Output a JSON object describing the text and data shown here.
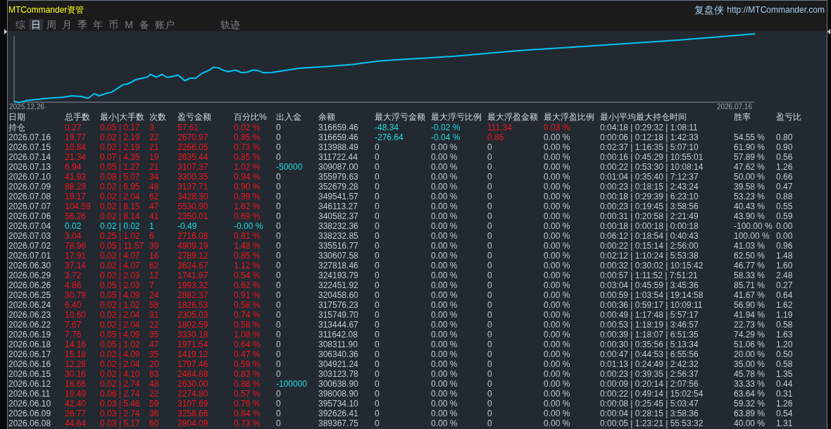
{
  "window": {
    "title": "MTCommander资管"
  },
  "header": {
    "site_name": "复盘侠",
    "url": "http://MTCommander.com"
  },
  "tabs": [
    {
      "label": "综",
      "selected": false
    },
    {
      "label": "日",
      "selected": true
    },
    {
      "label": "周",
      "selected": false
    },
    {
      "label": "月",
      "selected": false
    },
    {
      "label": "季",
      "selected": false
    },
    {
      "label": "年",
      "selected": false
    },
    {
      "label": "币",
      "selected": false
    },
    {
      "label": "M",
      "selected": false
    },
    {
      "label": "备",
      "selected": false
    },
    {
      "label": "账户",
      "selected": false
    }
  ],
  "tools": [
    {
      "label": "轨迹",
      "selected": false
    }
  ],
  "chart": {
    "start_label": "2025.12.26",
    "end_label": "2026.07.16"
  },
  "table": {
    "columns": [
      "日期",
      "总手数",
      "最小|大手数",
      "次数",
      "盈亏金额",
      "百分比%",
      "出入金",
      "余额",
      "最大浮亏金额",
      "最大浮亏比例",
      "最大浮盈金额",
      "最大浮盈比例",
      "最小|平均最大持仓时间",
      "胜率",
      "盈亏比"
    ],
    "rows": [
      {
        "cells": [
          {
            "text": "持仓"
          },
          {
            "text": "0.27",
            "color": "#f0161e"
          },
          {
            "text": "0.05 | 0.17",
            "color": "#f0161e"
          },
          {
            "text": "3",
            "color": "#f0161e"
          },
          {
            "text": "57.61",
            "color": "#f0161e"
          },
          {
            "text": "0.02 %",
            "color": "#f0161e"
          },
          {
            "text": "0"
          },
          {
            "text": "316659.46"
          },
          {
            "text": "-48.34",
            "color": "#1fdde3"
          },
          {
            "text": "-0.02 %",
            "color": "#1fdde3"
          },
          {
            "text": "111.34",
            "color": "#f0161e"
          },
          {
            "text": "0.03 %",
            "color": "#f0161e"
          },
          {
            "text": "0:04:18 | 0:29:32 | 1:08:11"
          }
        ]
      },
      {
        "cells": [
          {
            "text": "2026.07.16"
          },
          {
            "text": "19.77",
            "color": "#f0161e"
          },
          {
            "text": "0.02 | 2.19",
            "color": "#f0161e"
          },
          {
            "text": "22",
            "color": "#f0161e"
          },
          {
            "text": "2670.97",
            "color": "#f0161e"
          },
          {
            "text": "0.85 %",
            "color": "#f0161e"
          },
          {
            "text": "0"
          },
          {
            "text": "316659.46"
          },
          {
            "text": "-276.64",
            "color": "#1fdde3"
          },
          {
            "text": "-0.04 %",
            "color": "#1fdde3"
          },
          {
            "text": "0.85",
            "color": "#f0161e"
          },
          {
            "text": "0.00 %"
          },
          {
            "text": "0:00:06 | 0:12:18 | 1:42:33"
          },
          {
            "text": "54.55 %"
          },
          {
            "text": "0.80"
          }
        ]
      },
      {
        "cells": [
          {
            "text": "2026.07.15"
          },
          {
            "text": "10.84",
            "color": "#f0161e"
          },
          {
            "text": "0.02 | 2.19",
            "color": "#f0161e"
          },
          {
            "text": "21",
            "color": "#f0161e"
          },
          {
            "text": "2266.05",
            "color": "#f0161e"
          },
          {
            "text": "0.73 %",
            "color": "#f0161e"
          },
          {
            "text": "0"
          },
          {
            "text": "313988.49"
          },
          {
            "text": "0"
          },
          {
            "text": "0.00 %"
          },
          {
            "text": "0"
          },
          {
            "text": "0.00 %"
          },
          {
            "text": "0:02:37 | 1:16:35 | 5:07:10"
          },
          {
            "text": "61.90 %"
          },
          {
            "text": "0.90"
          }
        ]
      },
      {
        "cells": [
          {
            "text": "2026.07.14"
          },
          {
            "text": "21.34",
            "color": "#f0161e"
          },
          {
            "text": "0.07 | 4.35",
            "color": "#f0161e"
          },
          {
            "text": "19",
            "color": "#f0161e"
          },
          {
            "text": "2635.44",
            "color": "#f0161e"
          },
          {
            "text": "0.85 %",
            "color": "#f0161e"
          },
          {
            "text": "0"
          },
          {
            "text": "311722.44"
          },
          {
            "text": "0"
          },
          {
            "text": "0.00 %"
          },
          {
            "text": "0"
          },
          {
            "text": "0.00 %"
          },
          {
            "text": "0:00:16 | 0:45:29 | 10:55:01"
          },
          {
            "text": "57.89 %"
          },
          {
            "text": "0.56"
          }
        ]
      },
      {
        "cells": [
          {
            "text": "2026.07.13"
          },
          {
            "text": "6.94",
            "color": "#f0161e"
          },
          {
            "text": "0.05 | 1.27",
            "color": "#f0161e"
          },
          {
            "text": "21",
            "color": "#f0161e"
          },
          {
            "text": "3107.37",
            "color": "#f0161e"
          },
          {
            "text": "1.02 %",
            "color": "#f0161e"
          },
          {
            "text": "-50000",
            "color": "#1fdde3"
          },
          {
            "text": "309087.00"
          },
          {
            "text": "0"
          },
          {
            "text": "0.00 %"
          },
          {
            "text": "0"
          },
          {
            "text": "0.00 %"
          },
          {
            "text": "0:00:22 | 0:53:30 | 10:08:14"
          },
          {
            "text": "47.62 %"
          },
          {
            "text": "1.26"
          }
        ]
      },
      {
        "cells": [
          {
            "text": "2026.07.10"
          },
          {
            "text": "41.93",
            "color": "#f0161e"
          },
          {
            "text": "0.08 | 5.07",
            "color": "#f0161e"
          },
          {
            "text": "34",
            "color": "#f0161e"
          },
          {
            "text": "3300.35",
            "color": "#f0161e"
          },
          {
            "text": "0.94 %",
            "color": "#f0161e"
          },
          {
            "text": "0"
          },
          {
            "text": "355979.63"
          },
          {
            "text": "0"
          },
          {
            "text": "0.00 %"
          },
          {
            "text": "0"
          },
          {
            "text": "0.00 %"
          },
          {
            "text": "0:01:04 | 0:35:40 | 7:12:37"
          },
          {
            "text": "50.00 %"
          },
          {
            "text": "0.66"
          }
        ]
      },
      {
        "cells": [
          {
            "text": "2026.07.09"
          },
          {
            "text": "88.29",
            "color": "#f0161e"
          },
          {
            "text": "0.02 | 6.95",
            "color": "#f0161e"
          },
          {
            "text": "48",
            "color": "#f0161e"
          },
          {
            "text": "3137.71",
            "color": "#f0161e"
          },
          {
            "text": "0.90 %",
            "color": "#f0161e"
          },
          {
            "text": "0"
          },
          {
            "text": "352679.28"
          },
          {
            "text": "0"
          },
          {
            "text": "0.00 %"
          },
          {
            "text": "0"
          },
          {
            "text": "0.00 %"
          },
          {
            "text": "0:00:23 | 0:18:15 | 2:43:24"
          },
          {
            "text": "39.58 %"
          },
          {
            "text": "0.47"
          }
        ]
      },
      {
        "cells": [
          {
            "text": "2026.07.08"
          },
          {
            "text": "19.17",
            "color": "#f0161e"
          },
          {
            "text": "0.02 | 2.04",
            "color": "#f0161e"
          },
          {
            "text": "62",
            "color": "#f0161e"
          },
          {
            "text": "3428.30",
            "color": "#f0161e"
          },
          {
            "text": "0.99 %",
            "color": "#f0161e"
          },
          {
            "text": "0"
          },
          {
            "text": "349541.57"
          },
          {
            "text": "0"
          },
          {
            "text": "0.00 %"
          },
          {
            "text": "0"
          },
          {
            "text": "0.00 %"
          },
          {
            "text": "0:00:18 | 0:29:39 | 6:23:10"
          },
          {
            "text": "53.23 %"
          },
          {
            "text": "0.88"
          }
        ]
      },
      {
        "cells": [
          {
            "text": "2026.07.07"
          },
          {
            "text": "104.59",
            "color": "#f0161e"
          },
          {
            "text": "0.02 | 8.15",
            "color": "#f0161e"
          },
          {
            "text": "47",
            "color": "#f0161e"
          },
          {
            "text": "5530.90",
            "color": "#f0161e"
          },
          {
            "text": "1.62 %",
            "color": "#f0161e"
          },
          {
            "text": "0"
          },
          {
            "text": "346113.27"
          },
          {
            "text": "0"
          },
          {
            "text": "0.00 %"
          },
          {
            "text": "0"
          },
          {
            "text": "0.00 %"
          },
          {
            "text": "0:00:23 | 0:19:45 | 3:58:56"
          },
          {
            "text": "40.43 %"
          },
          {
            "text": "0.55"
          }
        ]
      },
      {
        "cells": [
          {
            "text": "2026.07.06"
          },
          {
            "text": "56.26",
            "color": "#f0161e"
          },
          {
            "text": "0.02 | 8.14",
            "color": "#f0161e"
          },
          {
            "text": "41",
            "color": "#f0161e"
          },
          {
            "text": "2350.01",
            "color": "#f0161e"
          },
          {
            "text": "0.69 %",
            "color": "#f0161e"
          },
          {
            "text": "0"
          },
          {
            "text": "340582.37"
          },
          {
            "text": "0"
          },
          {
            "text": "0.00 %"
          },
          {
            "text": "0"
          },
          {
            "text": "0.00 %"
          },
          {
            "text": "0:00:31 | 0:20:58 | 2:21:49"
          },
          {
            "text": "43.90 %"
          },
          {
            "text": "0.59"
          }
        ]
      },
      {
        "cells": [
          {
            "text": "2026.07.04"
          },
          {
            "text": "0.02",
            "color": "#1fdde3"
          },
          {
            "text": "0.02 | 0.02",
            "color": "#1fdde3"
          },
          {
            "text": "1",
            "color": "#1fdde3"
          },
          {
            "text": "-0.49",
            "color": "#1fdde3"
          },
          {
            "text": "-0.00 %",
            "color": "#1fdde3"
          },
          {
            "text": "0"
          },
          {
            "text": "338232.36"
          },
          {
            "text": "0"
          },
          {
            "text": "0.00 %"
          },
          {
            "text": "0"
          },
          {
            "text": "0.00 %"
          },
          {
            "text": "0:00:18 | 0:00:18 | 0:00:18"
          },
          {
            "text": "-100.00 %"
          },
          {
            "text": "0.00"
          }
        ]
      },
      {
        "cells": [
          {
            "text": "2026.07.03"
          },
          {
            "text": "3.04",
            "color": "#f0161e"
          },
          {
            "text": "0.25 | 1.02",
            "color": "#f0161e"
          },
          {
            "text": "6",
            "color": "#f0161e"
          },
          {
            "text": "2716.08",
            "color": "#f0161e"
          },
          {
            "text": "0.81 %",
            "color": "#f0161e"
          },
          {
            "text": "0"
          },
          {
            "text": "338232.85"
          },
          {
            "text": "0"
          },
          {
            "text": "0.00 %"
          },
          {
            "text": "0"
          },
          {
            "text": "0.00 %"
          },
          {
            "text": "0:06:12 | 0:18:54 | 0:40:43"
          },
          {
            "text": "100.00 %"
          },
          {
            "text": "0.00"
          }
        ]
      },
      {
        "cells": [
          {
            "text": "2026.07.02"
          },
          {
            "text": "78.96",
            "color": "#f0161e"
          },
          {
            "text": "0.05 | 11.57",
            "color": "#f0161e"
          },
          {
            "text": "39",
            "color": "#f0161e"
          },
          {
            "text": "4909.19",
            "color": "#f0161e"
          },
          {
            "text": "1.48 %",
            "color": "#f0161e"
          },
          {
            "text": "0"
          },
          {
            "text": "335516.77"
          },
          {
            "text": "0"
          },
          {
            "text": "0.00 %"
          },
          {
            "text": "0"
          },
          {
            "text": "0.00 %"
          },
          {
            "text": "0:00:22 | 0:15:14 | 2:56:00"
          },
          {
            "text": "41.03 %"
          },
          {
            "text": "0.96"
          }
        ]
      },
      {
        "cells": [
          {
            "text": "2026.07.01"
          },
          {
            "text": "17.91",
            "color": "#f0161e"
          },
          {
            "text": "0.02 | 4.07",
            "color": "#f0161e"
          },
          {
            "text": "16",
            "color": "#f0161e"
          },
          {
            "text": "2789.12",
            "color": "#f0161e"
          },
          {
            "text": "0.85 %",
            "color": "#f0161e"
          },
          {
            "text": "0"
          },
          {
            "text": "330607.58"
          },
          {
            "text": "0"
          },
          {
            "text": "0.00 %"
          },
          {
            "text": "0"
          },
          {
            "text": "0.00 %"
          },
          {
            "text": "0:02:12 | 1:10:24 | 5:53:38"
          },
          {
            "text": "62.50 %"
          },
          {
            "text": "1.48"
          }
        ]
      },
      {
        "cells": [
          {
            "text": "2026.06.30"
          },
          {
            "text": "37.14",
            "color": "#f0161e"
          },
          {
            "text": "0.02 | 4.07",
            "color": "#f0161e"
          },
          {
            "text": "62",
            "color": "#f0161e"
          },
          {
            "text": "3624.67",
            "color": "#f0161e"
          },
          {
            "text": "1.12 %",
            "color": "#f0161e"
          },
          {
            "text": "0"
          },
          {
            "text": "327818.46"
          },
          {
            "text": "0"
          },
          {
            "text": "0.00 %"
          },
          {
            "text": "0"
          },
          {
            "text": "0.00 %"
          },
          {
            "text": "0:00:32 | 0:30:02 | 10:15:42"
          },
          {
            "text": "46.77 %"
          },
          {
            "text": "1.60"
          }
        ]
      },
      {
        "cells": [
          {
            "text": "2026.06.29"
          },
          {
            "text": "3.72",
            "color": "#f0161e"
          },
          {
            "text": "0.02 | 2.03",
            "color": "#f0161e"
          },
          {
            "text": "12",
            "color": "#f0161e"
          },
          {
            "text": "1741.87",
            "color": "#f0161e"
          },
          {
            "text": "0.54 %",
            "color": "#f0161e"
          },
          {
            "text": "0"
          },
          {
            "text": "324193.79"
          },
          {
            "text": "0"
          },
          {
            "text": "0.00 %"
          },
          {
            "text": "0"
          },
          {
            "text": "0.00 %"
          },
          {
            "text": "0:00:57 | 1:11:52 | 7:51:21"
          },
          {
            "text": "58.33 %"
          },
          {
            "text": "2.48"
          }
        ]
      },
      {
        "cells": [
          {
            "text": "2026.06.26"
          },
          {
            "text": "4.86",
            "color": "#f0161e"
          },
          {
            "text": "0.05 | 2.03",
            "color": "#f0161e"
          },
          {
            "text": "7",
            "color": "#f0161e"
          },
          {
            "text": "1993.32",
            "color": "#f0161e"
          },
          {
            "text": "0.62 %",
            "color": "#f0161e"
          },
          {
            "text": "0"
          },
          {
            "text": "322451.92"
          },
          {
            "text": "0"
          },
          {
            "text": "0.00 %"
          },
          {
            "text": "0"
          },
          {
            "text": "0.00 %"
          },
          {
            "text": "0:03:04 | 0:45:59 | 3:45:36"
          },
          {
            "text": "85.71 %"
          },
          {
            "text": "0.27"
          }
        ]
      },
      {
        "cells": [
          {
            "text": "2026.06.25"
          },
          {
            "text": "30.79",
            "color": "#f0161e"
          },
          {
            "text": "0.05 | 4.09",
            "color": "#f0161e"
          },
          {
            "text": "24",
            "color": "#f0161e"
          },
          {
            "text": "2882.37",
            "color": "#f0161e"
          },
          {
            "text": "0.91 %",
            "color": "#f0161e"
          },
          {
            "text": "0"
          },
          {
            "text": "320458.60"
          },
          {
            "text": "0"
          },
          {
            "text": "0.00 %"
          },
          {
            "text": "0"
          },
          {
            "text": "0.00 %"
          },
          {
            "text": "0:00:59 | 1:03:54 | 19:14:58"
          },
          {
            "text": "41.67 %"
          },
          {
            "text": "0.64"
          }
        ]
      },
      {
        "cells": [
          {
            "text": "2026.06.24"
          },
          {
            "text": "6.40",
            "color": "#f0161e"
          },
          {
            "text": "0.02 | 1.02",
            "color": "#f0161e"
          },
          {
            "text": "58",
            "color": "#f0161e"
          },
          {
            "text": "1826.53",
            "color": "#f0161e"
          },
          {
            "text": "0.58 %",
            "color": "#f0161e"
          },
          {
            "text": "0"
          },
          {
            "text": "317576.23"
          },
          {
            "text": "0"
          },
          {
            "text": "0.00 %"
          },
          {
            "text": "0"
          },
          {
            "text": "0.00 %"
          },
          {
            "text": "0:00:36 | 0:59:17 | 10:09:11"
          },
          {
            "text": "56.90 %"
          },
          {
            "text": "1.62"
          }
        ]
      },
      {
        "cells": [
          {
            "text": "2026.06.23"
          },
          {
            "text": "10.60",
            "color": "#f0161e"
          },
          {
            "text": "0.02 | 2.04",
            "color": "#f0161e"
          },
          {
            "text": "31",
            "color": "#f0161e"
          },
          {
            "text": "2305.03",
            "color": "#f0161e"
          },
          {
            "text": "0.74 %",
            "color": "#f0161e"
          },
          {
            "text": "0"
          },
          {
            "text": "315749.70"
          },
          {
            "text": "0"
          },
          {
            "text": "0.00 %"
          },
          {
            "text": "0"
          },
          {
            "text": "0.00 %"
          },
          {
            "text": "0:00:49 | 1:17:48 | 5:57:17"
          },
          {
            "text": "41.94 %"
          },
          {
            "text": "1.19"
          }
        ]
      },
      {
        "cells": [
          {
            "text": "2026.06.22"
          },
          {
            "text": "7.67",
            "color": "#f0161e"
          },
          {
            "text": "0.02 | 2.04",
            "color": "#f0161e"
          },
          {
            "text": "22",
            "color": "#f0161e"
          },
          {
            "text": "1802.59",
            "color": "#f0161e"
          },
          {
            "text": "0.58 %",
            "color": "#f0161e"
          },
          {
            "text": "0"
          },
          {
            "text": "313444.67"
          },
          {
            "text": "0"
          },
          {
            "text": "0.00 %"
          },
          {
            "text": "0"
          },
          {
            "text": "0.00 %"
          },
          {
            "text": "0:00:53 | 1:18:19 | 3:46:57"
          },
          {
            "text": "22.73 %"
          },
          {
            "text": "0.58"
          }
        ]
      },
      {
        "cells": [
          {
            "text": "2026.06.19"
          },
          {
            "text": "7.76",
            "color": "#f0161e"
          },
          {
            "text": "0.05 | 4.09",
            "color": "#f0161e"
          },
          {
            "text": "35",
            "color": "#f0161e"
          },
          {
            "text": "3330.18",
            "color": "#f0161e"
          },
          {
            "text": "1.08 %",
            "color": "#f0161e"
          },
          {
            "text": "0"
          },
          {
            "text": "311642.08"
          },
          {
            "text": "0"
          },
          {
            "text": "0.00 %"
          },
          {
            "text": "0"
          },
          {
            "text": "0.00 %"
          },
          {
            "text": "0:00:39 | 1:18:07 | 6:51:35"
          },
          {
            "text": "74.29 %"
          },
          {
            "text": "1.63"
          }
        ]
      },
      {
        "cells": [
          {
            "text": "2026.06.18"
          },
          {
            "text": "14.16",
            "color": "#f0161e"
          },
          {
            "text": "0.05 | 1.02",
            "color": "#f0161e"
          },
          {
            "text": "47",
            "color": "#f0161e"
          },
          {
            "text": "1971.54",
            "color": "#f0161e"
          },
          {
            "text": "0.64 %",
            "color": "#f0161e"
          },
          {
            "text": "0"
          },
          {
            "text": "308311.90"
          },
          {
            "text": "0"
          },
          {
            "text": "0.00 %"
          },
          {
            "text": "0"
          },
          {
            "text": "0.00 %"
          },
          {
            "text": "0:00:30 | 0:35:56 | 5:13:34"
          },
          {
            "text": "51.06 %"
          },
          {
            "text": "1.20"
          }
        ]
      },
      {
        "cells": [
          {
            "text": "2026.06.17"
          },
          {
            "text": "15.18",
            "color": "#f0161e"
          },
          {
            "text": "0.02 | 4.09",
            "color": "#f0161e"
          },
          {
            "text": "35",
            "color": "#f0161e"
          },
          {
            "text": "1419.12",
            "color": "#f0161e"
          },
          {
            "text": "0.47 %",
            "color": "#f0161e"
          },
          {
            "text": "0"
          },
          {
            "text": "306340.36"
          },
          {
            "text": "0"
          },
          {
            "text": "0.00 %"
          },
          {
            "text": "0"
          },
          {
            "text": "0.00 %"
          },
          {
            "text": "0:00:47 | 0:44:53 | 6:55:56"
          },
          {
            "text": "20.00 %"
          },
          {
            "text": "0.50"
          }
        ]
      },
      {
        "cells": [
          {
            "text": "2026.06.16"
          },
          {
            "text": "12.28",
            "color": "#f0161e"
          },
          {
            "text": "0.02 | 2.04",
            "color": "#f0161e"
          },
          {
            "text": "20",
            "color": "#f0161e"
          },
          {
            "text": "1797.46",
            "color": "#f0161e"
          },
          {
            "text": "0.59 %",
            "color": "#f0161e"
          },
          {
            "text": "0"
          },
          {
            "text": "304921.24"
          },
          {
            "text": "0"
          },
          {
            "text": "0.00 %"
          },
          {
            "text": "0"
          },
          {
            "text": "0.00 %"
          },
          {
            "text": "0:01:13 | 0:24:49 | 2:42:32"
          },
          {
            "text": "35.00 %"
          },
          {
            "text": "0.58"
          }
        ]
      },
      {
        "cells": [
          {
            "text": "2026.06.15"
          },
          {
            "text": "30.16",
            "color": "#f0161e"
          },
          {
            "text": "0.02 | 4.10",
            "color": "#f0161e"
          },
          {
            "text": "83",
            "color": "#f0161e"
          },
          {
            "text": "2484.88",
            "color": "#f0161e"
          },
          {
            "text": "0.83 %",
            "color": "#f0161e"
          },
          {
            "text": "0"
          },
          {
            "text": "303123.78"
          },
          {
            "text": "0"
          },
          {
            "text": "0.00 %"
          },
          {
            "text": "0"
          },
          {
            "text": "0.00 %"
          },
          {
            "text": "0:00:23 | 0:39:35 | 2:56:37"
          },
          {
            "text": "45.78 %"
          },
          {
            "text": "1.35"
          }
        ]
      },
      {
        "cells": [
          {
            "text": "2026.06.12"
          },
          {
            "text": "16.66",
            "color": "#f0161e"
          },
          {
            "text": "0.02 | 2.74",
            "color": "#f0161e"
          },
          {
            "text": "48",
            "color": "#f0161e"
          },
          {
            "text": "2630.00",
            "color": "#f0161e"
          },
          {
            "text": "0.88 %",
            "color": "#f0161e"
          },
          {
            "text": "-100000",
            "color": "#1fdde3"
          },
          {
            "text": "300638.90"
          },
          {
            "text": "0"
          },
          {
            "text": "0.00 %"
          },
          {
            "text": "0"
          },
          {
            "text": "0.00 %"
          },
          {
            "text": "0:00:09 | 0:20:14 | 2:07:56"
          },
          {
            "text": "33.33 %"
          },
          {
            "text": "0.44"
          }
        ]
      },
      {
        "cells": [
          {
            "text": "2026.06.11"
          },
          {
            "text": "19.49",
            "color": "#f0161e"
          },
          {
            "text": "0.06 | 2.74",
            "color": "#f0161e"
          },
          {
            "text": "22",
            "color": "#f0161e"
          },
          {
            "text": "2274.80",
            "color": "#f0161e"
          },
          {
            "text": "0.57 %",
            "color": "#f0161e"
          },
          {
            "text": "0"
          },
          {
            "text": "398008.90"
          },
          {
            "text": "0"
          },
          {
            "text": "0.00 %"
          },
          {
            "text": "0"
          },
          {
            "text": "0.00 %"
          },
          {
            "text": "0:00:22 | 0:49:14 | 15:02:54"
          },
          {
            "text": "63.64 %"
          },
          {
            "text": "0.31"
          }
        ]
      },
      {
        "cells": [
          {
            "text": "2026.06.10"
          },
          {
            "text": "42.40",
            "color": "#f0161e"
          },
          {
            "text": "0.03 | 5.46",
            "color": "#f0161e"
          },
          {
            "text": "59",
            "color": "#f0161e"
          },
          {
            "text": "3107.69",
            "color": "#f0161e"
          },
          {
            "text": "0.79 %",
            "color": "#f0161e"
          },
          {
            "text": "0"
          },
          {
            "text": "395734.10"
          },
          {
            "text": "0"
          },
          {
            "text": "0.00 %"
          },
          {
            "text": "0"
          },
          {
            "text": "0.00 %"
          },
          {
            "text": "0:00:08 | 0:25:45 | 5:03:47"
          },
          {
            "text": "59.32 %"
          },
          {
            "text": "1.26"
          }
        ]
      },
      {
        "cells": [
          {
            "text": "2026.06.09"
          },
          {
            "text": "26.77",
            "color": "#f0161e"
          },
          {
            "text": "0.03 | 2.74",
            "color": "#f0161e"
          },
          {
            "text": "36",
            "color": "#f0161e"
          },
          {
            "text": "3258.66",
            "color": "#f0161e"
          },
          {
            "text": "0.84 %",
            "color": "#f0161e"
          },
          {
            "text": "0"
          },
          {
            "text": "392626.41"
          },
          {
            "text": "0"
          },
          {
            "text": "0.00 %"
          },
          {
            "text": "0"
          },
          {
            "text": "0.00 %"
          },
          {
            "text": "0:00:04 | 0:28:15 | 3:58:36"
          },
          {
            "text": "63.89 %"
          },
          {
            "text": "0.54"
          }
        ]
      },
      {
        "cells": [
          {
            "text": "2026.06.08"
          },
          {
            "text": "44.64",
            "color": "#f0161e"
          },
          {
            "text": "0.03 | 5.17",
            "color": "#f0161e"
          },
          {
            "text": "60",
            "color": "#f0161e"
          },
          {
            "text": "2804.09",
            "color": "#f0161e"
          },
          {
            "text": "0.73 %",
            "color": "#f0161e"
          },
          {
            "text": "0"
          },
          {
            "text": "389367.75"
          },
          {
            "text": "0"
          },
          {
            "text": "0.00 %"
          },
          {
            "text": "0"
          },
          {
            "text": "0.00 %"
          },
          {
            "text": "0:00:05 | 1:23:21 | 55:53:32"
          },
          {
            "text": "40.00 %"
          },
          {
            "text": "1.31"
          }
        ]
      }
    ]
  }
}
